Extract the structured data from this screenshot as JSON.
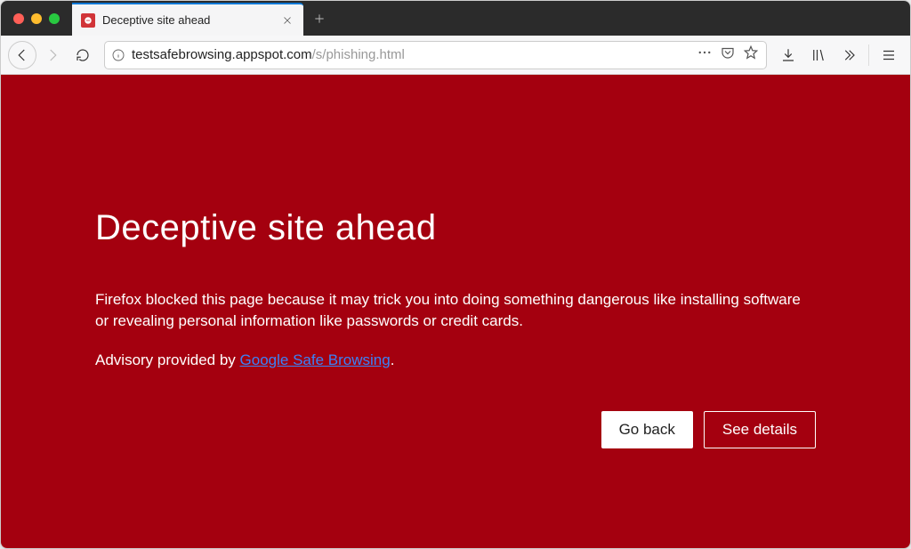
{
  "tab": {
    "title": "Deceptive site ahead"
  },
  "url": {
    "host": "testsafebrowsing.appspot.com",
    "path": "/s/phishing.html"
  },
  "warning": {
    "heading": "Deceptive site ahead",
    "body": "Firefox blocked this page because it may trick you into doing something dangerous like installing software or revealing personal information like passwords or credit cards.",
    "advisory_prefix": "Advisory provided by ",
    "advisory_link_text": "Google Safe Browsing",
    "advisory_suffix": "."
  },
  "buttons": {
    "go_back": "Go back",
    "see_details": "See details"
  },
  "colors": {
    "warning_bg": "#a4000f",
    "link": "#3b82f6"
  }
}
